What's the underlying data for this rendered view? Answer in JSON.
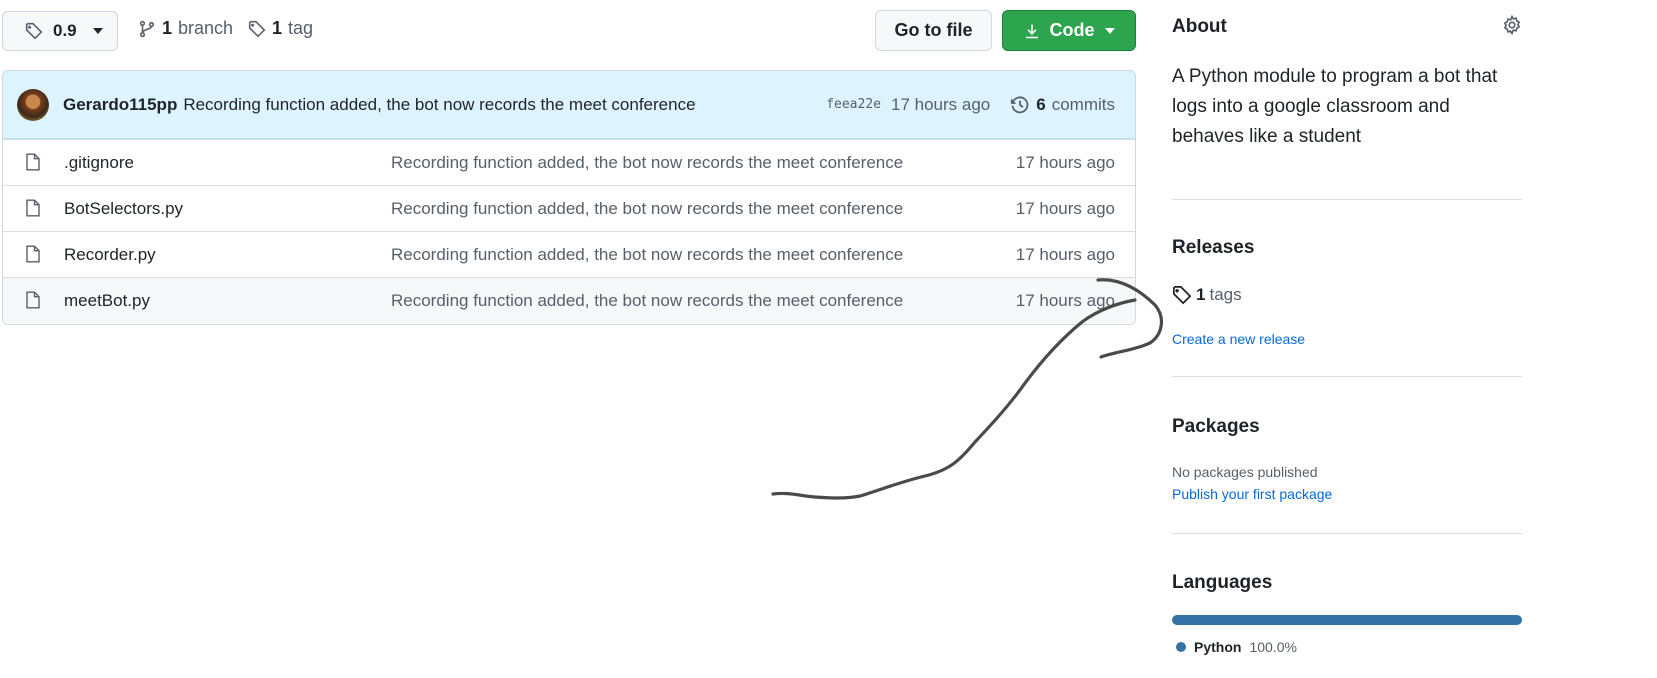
{
  "toolbar": {
    "branch_name": "0.9",
    "branch_count": "1",
    "branch_label": "branch",
    "tag_count": "1",
    "tag_label": "tag",
    "go_to_file_label": "Go to file",
    "code_label": "Code"
  },
  "latest_commit": {
    "author": "Gerardo115pp",
    "message": "Recording function added, the bot now records the meet conference",
    "sha": "feea22e",
    "time": "17 hours ago",
    "commit_count": "6",
    "commits_label": "commits"
  },
  "files": [
    {
      "name": ".gitignore",
      "commit": "Recording function added, the bot now records the meet conference",
      "age": "17 hours ago"
    },
    {
      "name": "BotSelectors.py",
      "commit": "Recording function added, the bot now records the meet conference",
      "age": "17 hours ago"
    },
    {
      "name": "Recorder.py",
      "commit": "Recording function added, the bot now records the meet conference",
      "age": "17 hours ago"
    },
    {
      "name": "meetBot.py",
      "commit": "Recording function added, the bot now records the meet conference",
      "age": "17 hours ago"
    }
  ],
  "sidebar": {
    "about_title": "About",
    "about_description": "A Python module to program a bot that logs into a google classroom and behaves like a student",
    "releases_title": "Releases",
    "release_tag_count": "1",
    "release_tag_label": "tags",
    "create_release_label": "Create a new release",
    "packages_title": "Packages",
    "no_packages_text": "No packages published",
    "publish_package_label": "Publish your first package",
    "languages_title": "Languages",
    "languages": [
      {
        "name": "Python",
        "percent": "100.0%",
        "color": "#3572A5"
      }
    ]
  },
  "icons": {
    "tag": "tag-icon",
    "branch": "git-branch-icon",
    "download": "download-icon",
    "history": "history-icon",
    "file": "file-icon",
    "gear": "gear-icon"
  },
  "colors": {
    "accent_green": "#2da44e",
    "link_blue": "#0969da",
    "commit_header_bg": "#ddf4ff",
    "python": "#3572A5"
  }
}
